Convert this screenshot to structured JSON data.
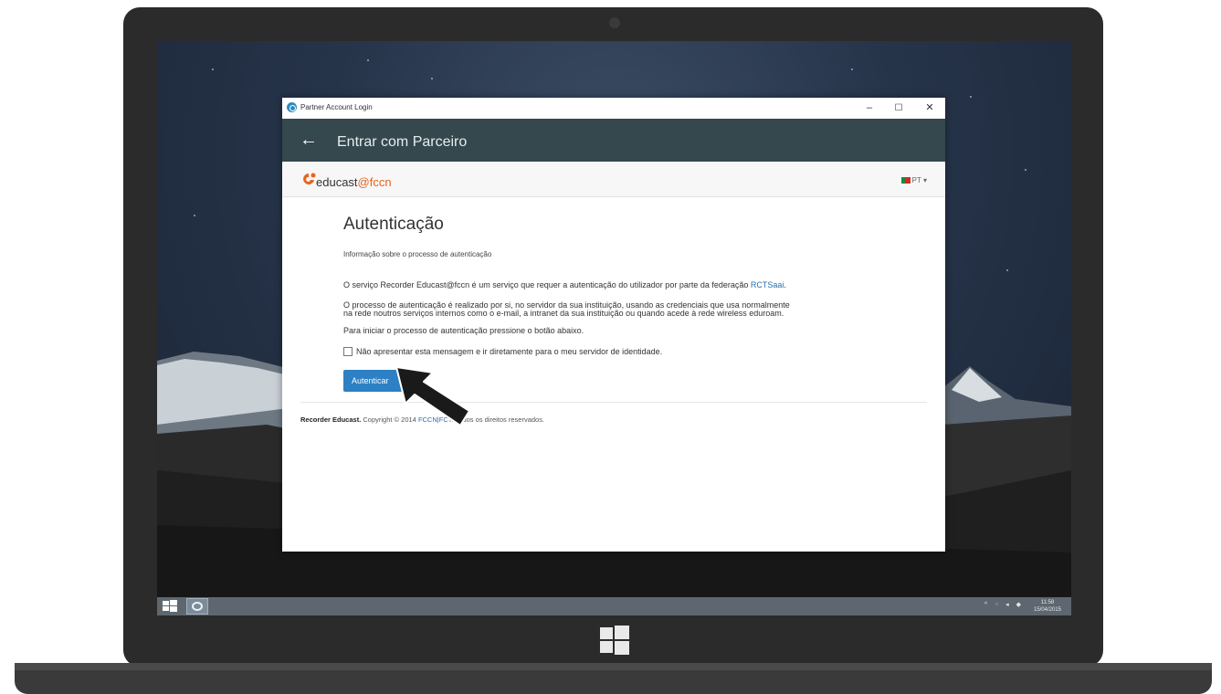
{
  "window": {
    "title": "Partner Account Login",
    "minimize": "–",
    "maximize": "☐",
    "close": "✕"
  },
  "header": {
    "back": "←",
    "title": "Entrar com Parceiro"
  },
  "brand": {
    "name": "educast",
    "suffix": "@fccn",
    "language": "PT ▾"
  },
  "content": {
    "title": "Autenticação",
    "subtitle": "Informação sobre o processo de autenticação",
    "para1": "O serviço Recorder Educast@fccn é um serviço que requer a autenticação do utilizador por parte da federação ",
    "para1_link": "RCTSaai",
    "para1_end": ".",
    "para2_line1": "O processo de autenticação é realizado por si, no servidor da sua instituição, usando as credenciais que usa normalmente",
    "para2_line2": "na rede noutros serviços internos como o e-mail, a intranet da sua instituição ou quando acede à rede wireless eduroam.",
    "para3": "Para iniciar o processo de autenticação pressione o botão abaixo.",
    "checkbox_label": "Não apresentar esta mensagem e ir diretamente para o meu servidor de identidade.",
    "button": "Autenticar"
  },
  "footer": {
    "product": "Recorder Educast.",
    "copyright": " Copyright © 2014 ",
    "link1": "FCCN",
    "separator": "|",
    "link2": "FCT",
    "rights": ". Todos os direitos reservados."
  },
  "taskbar": {
    "tray": "^ ⁖ ◂ ◆",
    "time": "11:58",
    "date": "15/04/2015"
  },
  "colors": {
    "header_bg": "#34484e",
    "accent": "#e8641c",
    "button": "#2d80c3",
    "link": "#2a6fb0"
  }
}
